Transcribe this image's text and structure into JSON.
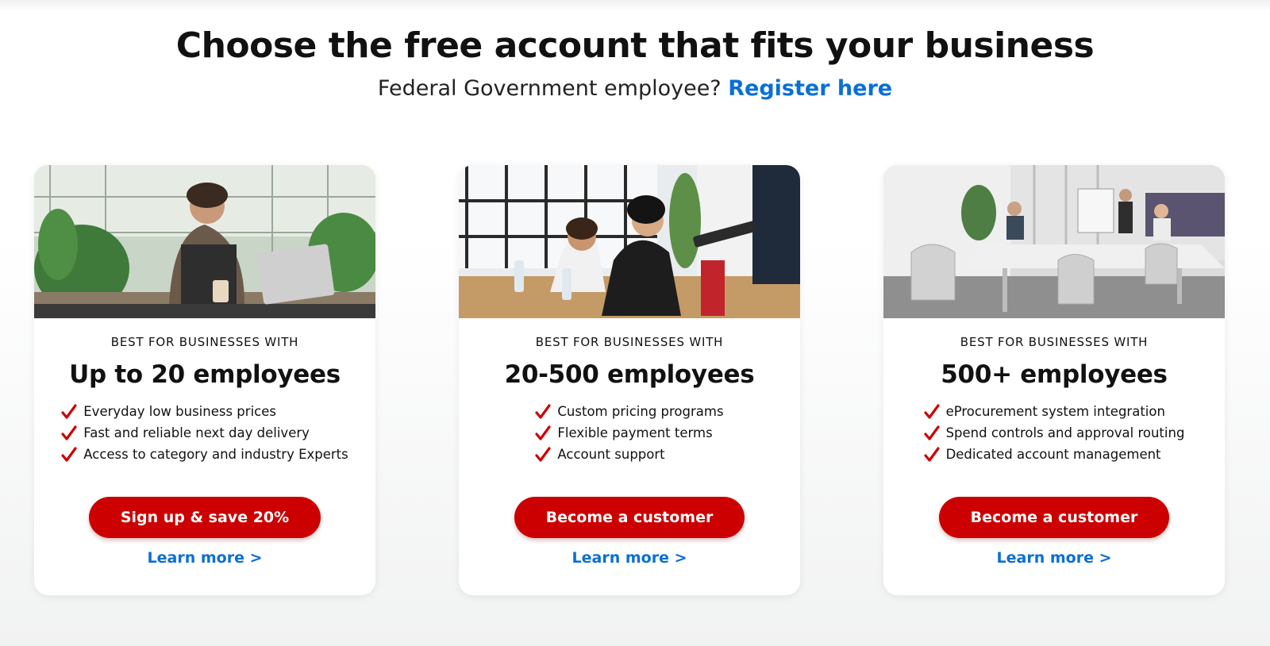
{
  "header": {
    "headline": "Choose the free account that fits your business",
    "sub_text": "Federal Government employee? ",
    "sub_link": "Register here"
  },
  "colors": {
    "accent": "#cc0000",
    "link": "#0a6fd6"
  },
  "cards": [
    {
      "eyebrow": "BEST FOR BUSINESSES WITH",
      "title": "Up to 20 employees",
      "features": [
        "Everyday low business prices",
        "Fast and reliable next day delivery",
        "Access to category and industry Experts"
      ],
      "button": "Sign up & save 20%",
      "learn_more": "Learn more >"
    },
    {
      "eyebrow": "BEST FOR BUSINESSES WITH",
      "title": "20-500 employees",
      "features": [
        "Custom pricing programs",
        "Flexible payment terms",
        "Account support"
      ],
      "button": "Become a customer",
      "learn_more": "Learn more >"
    },
    {
      "eyebrow": "BEST FOR BUSINESSES WITH",
      "title": "500+ employees",
      "features": [
        "eProcurement system integration",
        "Spend controls and approval routing",
        "Dedicated account management"
      ],
      "button": "Become a customer",
      "learn_more": "Learn more >"
    }
  ]
}
